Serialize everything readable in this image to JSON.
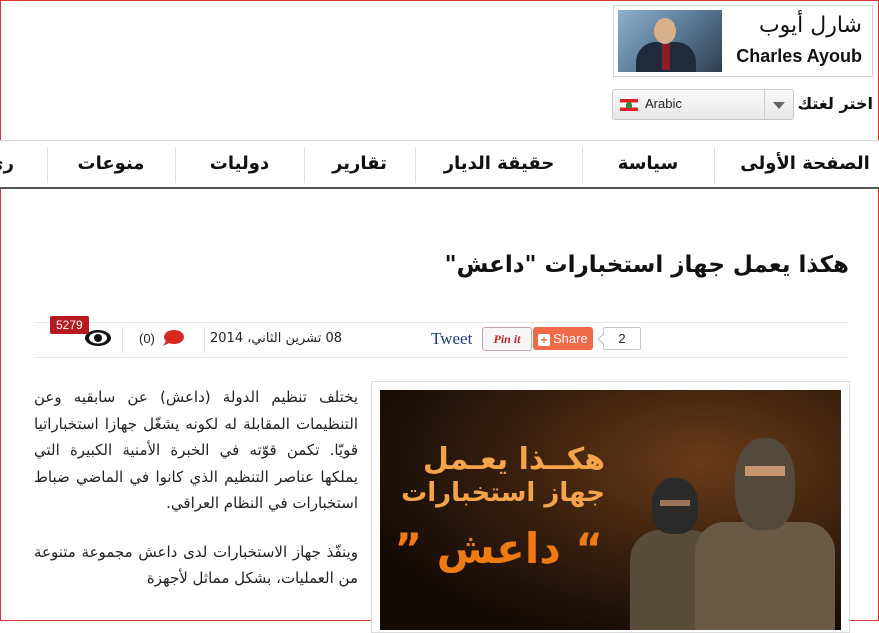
{
  "columnist": {
    "name_ar": "شارل أيوب",
    "name_en": "Charles Ayoub"
  },
  "language": {
    "label": "اختر لغتك",
    "selected": "Arabic"
  },
  "nav": {
    "items": [
      "الصفحة الأولى",
      "سياسة",
      "حقيقة الديار",
      "تقارير",
      "دوليات",
      "منوعات",
      "ري"
    ]
  },
  "article": {
    "title": "هكذا يعمل جهاز استخبارات \"داعش\"",
    "date": "08 تشرين الثاني، 2014",
    "views": "5279",
    "comments": "(0)",
    "share": {
      "tweet": "Tweet",
      "pin": "Pin it",
      "share": "Share",
      "count": "2"
    },
    "image_text": {
      "line1": "هكــذا يعـمل",
      "line2": "جهاز استخبارات",
      "line3": "“ داعش ”"
    },
    "paragraphs": [
      "يختلف تنظيم الدولة (داعش) عن سابقيه وعن التنظيمات المقابلة له لكونه يشغّل جهازا استخباراتيا قويّا. تكمن قوّته في الخبرة الأمنية الكبيرة التي يملكها عناصر التنظيم الذي كانوا في الماضي ضباط استخبارات في النظام العراقي.",
      "وينفّذ جهاز الاستخبارات لدى داعش مجموعة متنوعة من العمليات، بشكل مماثل لأجهزة"
    ]
  },
  "colors": {
    "badge": "#b8191f",
    "share": "#f06a47",
    "image_accent": "#f08a1d"
  }
}
